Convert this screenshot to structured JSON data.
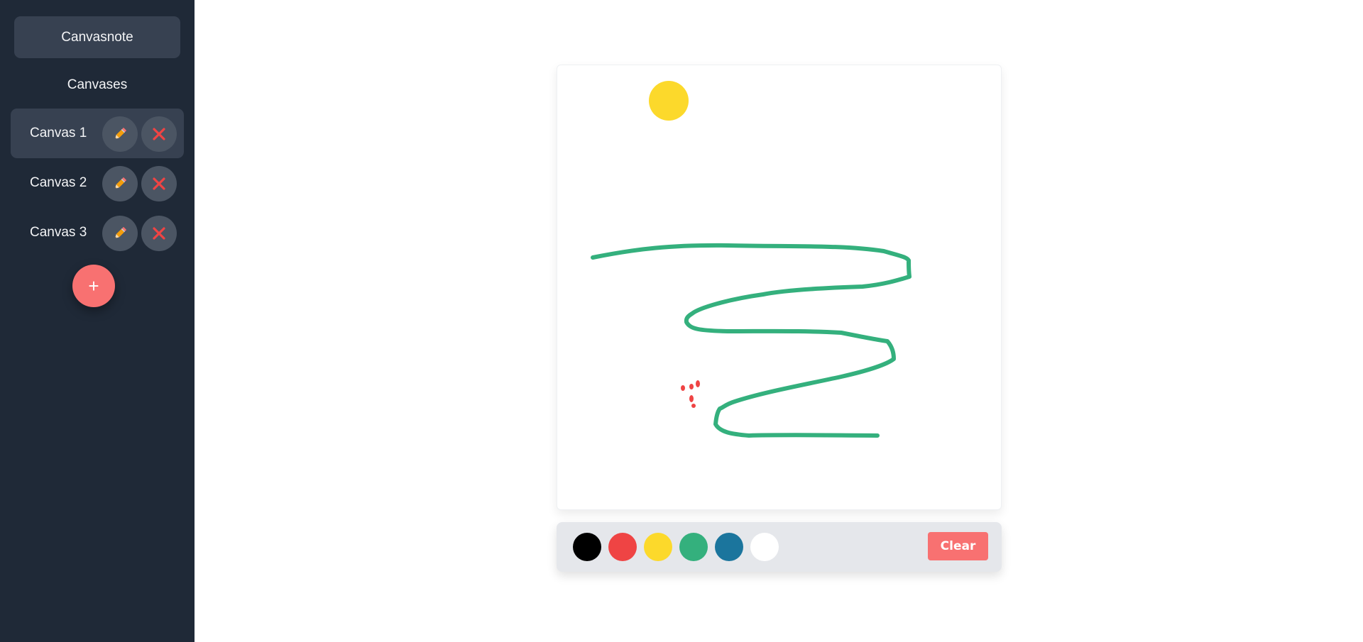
{
  "app": {
    "title": "Canvasnote"
  },
  "sidebar": {
    "section_title": "Canvases",
    "items": [
      {
        "label": "Canvas 1",
        "active": true
      },
      {
        "label": "Canvas 2",
        "active": false
      },
      {
        "label": "Canvas 3",
        "active": false
      }
    ],
    "add_label": "+",
    "icons": {
      "edit": "pencil-icon",
      "delete": "close-icon"
    }
  },
  "toolbar": {
    "colors": [
      {
        "name": "black",
        "hex": "#000000"
      },
      {
        "name": "red",
        "hex": "#ef4444"
      },
      {
        "name": "yellow",
        "hex": "#fcd92b"
      },
      {
        "name": "green",
        "hex": "#34b07d"
      },
      {
        "name": "blue",
        "hex": "#1b759d"
      },
      {
        "name": "white",
        "hex": "#ffffff"
      }
    ],
    "clear_label": "Clear"
  },
  "theme": {
    "sidebar_bg": "#1f2937",
    "item_bg": "#374151",
    "icon_btn_bg": "#4b5563",
    "accent": "#f87171",
    "toolbar_bg": "#e5e7eb"
  }
}
